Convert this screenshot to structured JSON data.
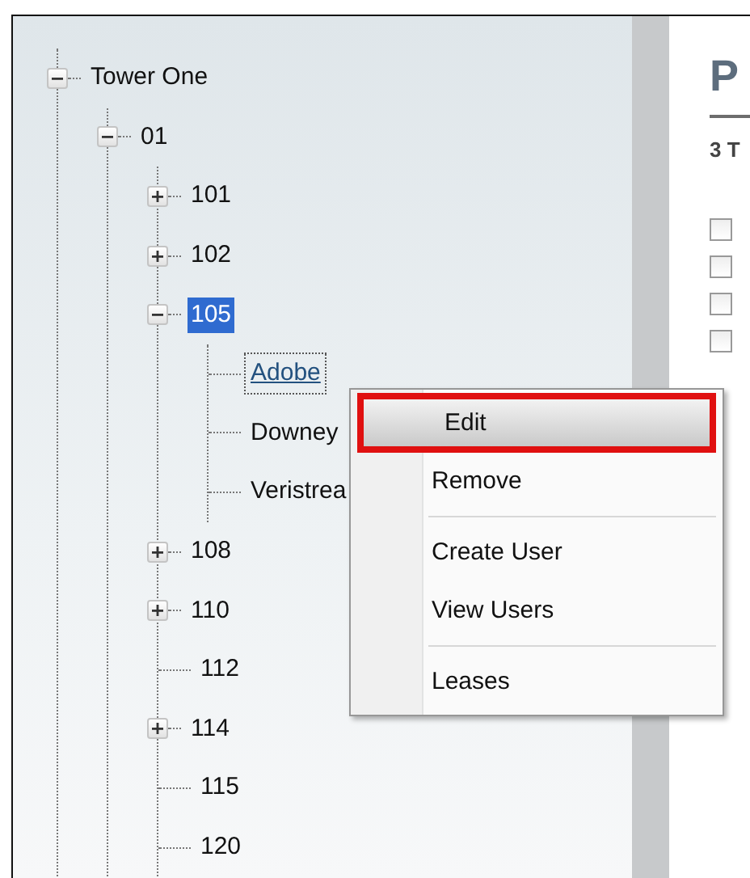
{
  "tree": [
    {
      "label": "Tower One",
      "expanded": true,
      "selected": false,
      "focused": false,
      "children": [
        {
          "label": "01",
          "expanded": true,
          "selected": false,
          "focused": false,
          "children": [
            {
              "label": "101",
              "expanded": false,
              "selected": false,
              "focused": false
            },
            {
              "label": "102",
              "expanded": false,
              "selected": false,
              "focused": false
            },
            {
              "label": "105",
              "expanded": true,
              "selected": true,
              "focused": false,
              "children": [
                {
                  "label": "Adobe",
                  "selected": false,
                  "focused": true
                },
                {
                  "label": "Downey",
                  "selected": false,
                  "focused": false
                },
                {
                  "label": "Veristrea",
                  "selected": false,
                  "focused": false
                }
              ]
            },
            {
              "label": "108",
              "expanded": false,
              "selected": false,
              "focused": false
            },
            {
              "label": "110",
              "expanded": false,
              "selected": false,
              "focused": false
            },
            {
              "label": "112",
              "selected": false,
              "focused": false
            },
            {
              "label": "114",
              "expanded": false,
              "selected": false,
              "focused": false
            },
            {
              "label": "115",
              "selected": false,
              "focused": false
            },
            {
              "label": "120",
              "selected": false,
              "focused": false
            }
          ]
        }
      ]
    }
  ],
  "context_menu": [
    {
      "kind": "item",
      "label": "Edit",
      "selected": true
    },
    {
      "kind": "item",
      "label": "Remove",
      "selected": false
    },
    {
      "kind": "separator"
    },
    {
      "kind": "item",
      "label": "Create User",
      "selected": false
    },
    {
      "kind": "item",
      "label": "View Users",
      "selected": false
    },
    {
      "kind": "separator"
    },
    {
      "kind": "item",
      "label": "Leases",
      "selected": false
    }
  ],
  "content": {
    "heading": "P",
    "subheading": "3 T",
    "checkboxes": [
      {
        "checked": false
      },
      {
        "checked": false
      },
      {
        "checked": false
      },
      {
        "checked": false
      }
    ]
  }
}
